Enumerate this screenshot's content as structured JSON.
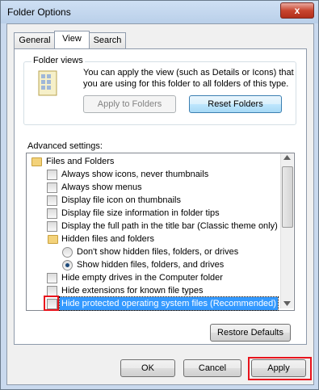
{
  "window": {
    "title": "Folder Options",
    "close_label": "x"
  },
  "tabs": [
    {
      "label": "General"
    },
    {
      "label": "View"
    },
    {
      "label": "Search"
    }
  ],
  "folder_views": {
    "group_label": "Folder views",
    "description": "You can apply the view (such as Details or Icons) that you are using for this folder to all folders of this type.",
    "apply_to_folders": "Apply to Folders",
    "reset_folders": "Reset Folders"
  },
  "advanced": {
    "label": "Advanced settings:",
    "items": [
      {
        "type": "folder",
        "label": "Files and Folders"
      },
      {
        "type": "checkbox",
        "label": "Always show icons, never thumbnails",
        "checked": false
      },
      {
        "type": "checkbox",
        "label": "Always show menus",
        "checked": false
      },
      {
        "type": "checkbox",
        "label": "Display file icon on thumbnails",
        "checked": false
      },
      {
        "type": "checkbox",
        "label": "Display file size information in folder tips",
        "checked": false
      },
      {
        "type": "checkbox",
        "label": "Display the full path in the title bar (Classic theme only)",
        "checked": false
      },
      {
        "type": "folder",
        "label": "Hidden files and folders"
      },
      {
        "type": "radio",
        "label": "Don't show hidden files, folders, or drives",
        "checked": false
      },
      {
        "type": "radio",
        "label": "Show hidden files, folders, and drives",
        "checked": true
      },
      {
        "type": "checkbox",
        "label": "Hide empty drives in the Computer folder",
        "checked": false
      },
      {
        "type": "checkbox",
        "label": "Hide extensions for known file types",
        "checked": false
      },
      {
        "type": "checkbox",
        "label": "Hide protected operating system files (Recommended)",
        "checked": false,
        "selected": true
      }
    ],
    "restore_defaults": "Restore Defaults"
  },
  "footer": {
    "ok": "OK",
    "cancel": "Cancel",
    "apply": "Apply"
  },
  "colors": {
    "highlight_box": "#e8141c",
    "selection": "#3399ff"
  }
}
